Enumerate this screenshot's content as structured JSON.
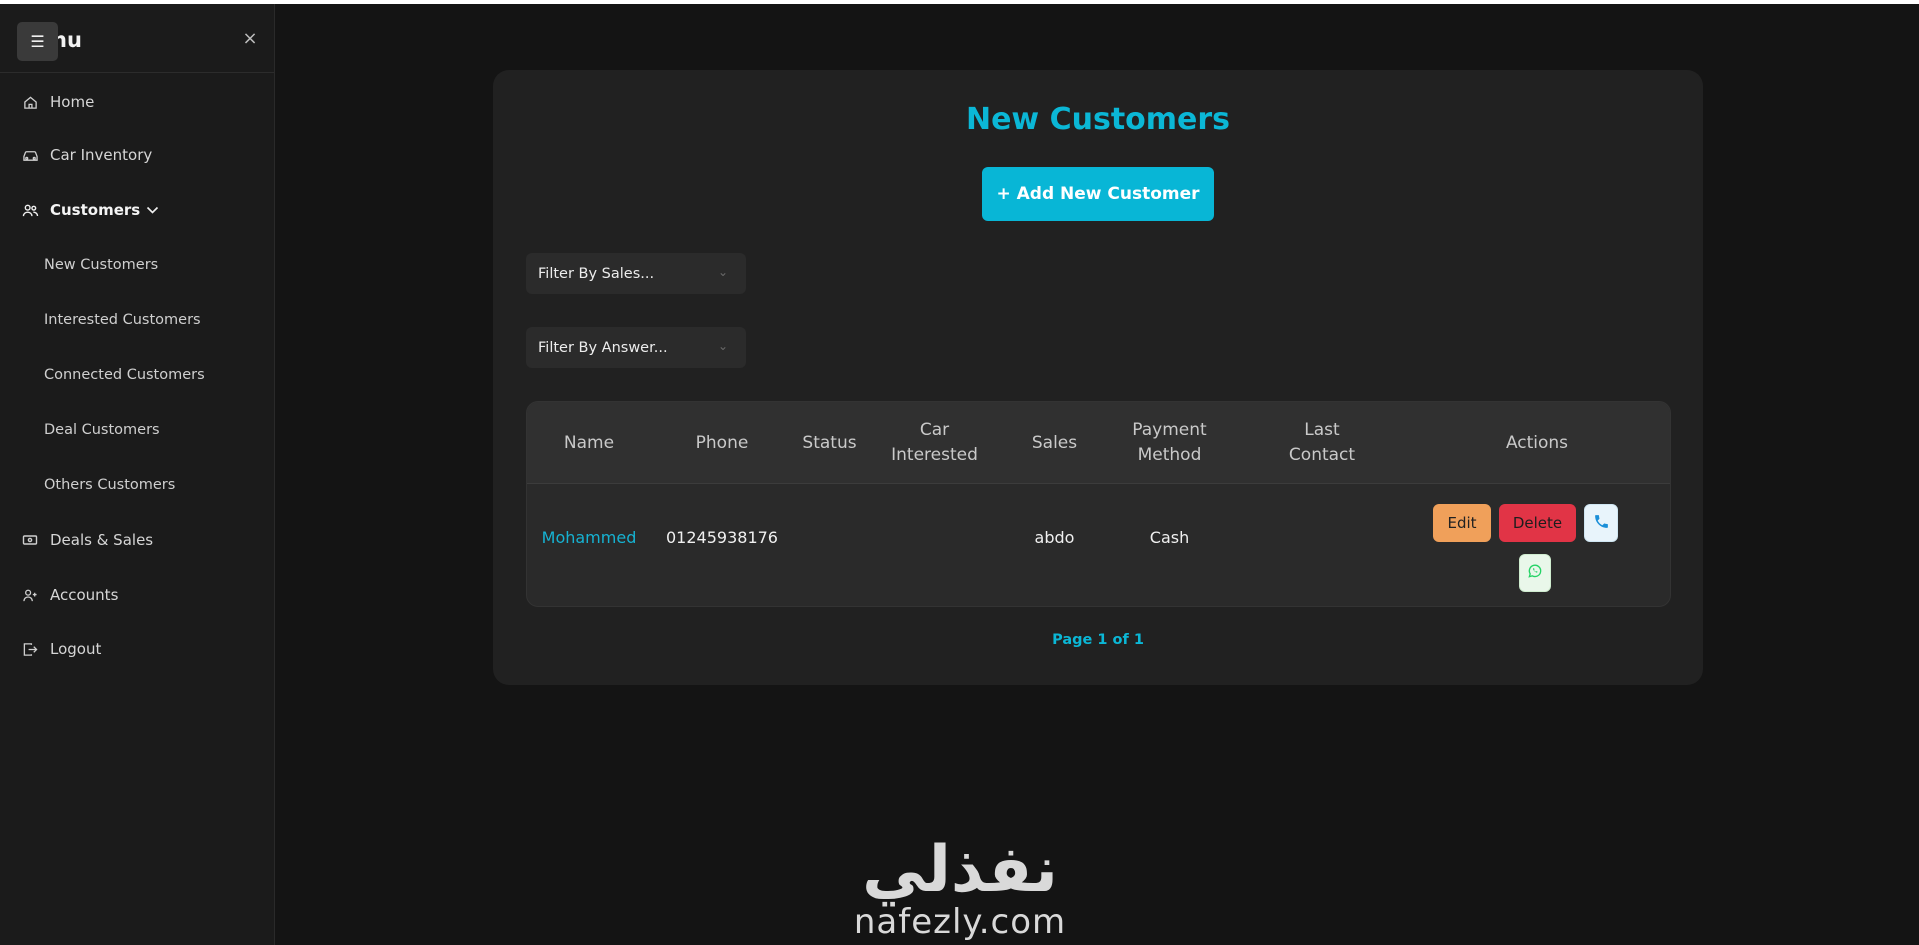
{
  "sidebar": {
    "title": "nu",
    "items": [
      {
        "label": "Home",
        "icon": "home-icon"
      },
      {
        "label": "Car Inventory",
        "icon": "car-icon"
      },
      {
        "label": "Customers",
        "icon": "users-icon"
      },
      {
        "label": "Deals & Sales",
        "icon": "money-icon"
      },
      {
        "label": "Accounts",
        "icon": "user-plus-icon"
      },
      {
        "label": "Logout",
        "icon": "logout-icon"
      }
    ],
    "sub_items": [
      {
        "label": "New Customers"
      },
      {
        "label": "Interested Customers"
      },
      {
        "label": "Connected Customers"
      },
      {
        "label": "Deal Customers"
      },
      {
        "label": "Others Customers"
      }
    ]
  },
  "main": {
    "title": "New Customers",
    "add_button": "+ Add New Customer",
    "filters": {
      "sales": "Filter By Sales...",
      "answer": "Filter By Answer..."
    },
    "table": {
      "headers": {
        "name": "Name",
        "phone": "Phone",
        "status": "Status",
        "car1": "Car",
        "car2": "Interested",
        "sales": "Sales",
        "pay1": "Payment",
        "pay2": "Method",
        "last1": "Last",
        "last2": "Contact",
        "actions": "Actions"
      },
      "rows": [
        {
          "name": "Mohammed",
          "phone": "01245938176",
          "status": "",
          "car": "",
          "sales": "abdo",
          "payment": "Cash",
          "last_contact": ""
        }
      ],
      "actions": {
        "edit": "Edit",
        "delete": "Delete"
      }
    },
    "pager": "Page 1 of 1"
  },
  "watermark": {
    "arabic": "نفذلي",
    "latin": "nafezly.com"
  },
  "colors": {
    "accent": "#08b6d6",
    "edit": "#f0a05a",
    "delete": "#e13446",
    "whatsapp": "#25d366",
    "phone": "#1a8fd8"
  }
}
